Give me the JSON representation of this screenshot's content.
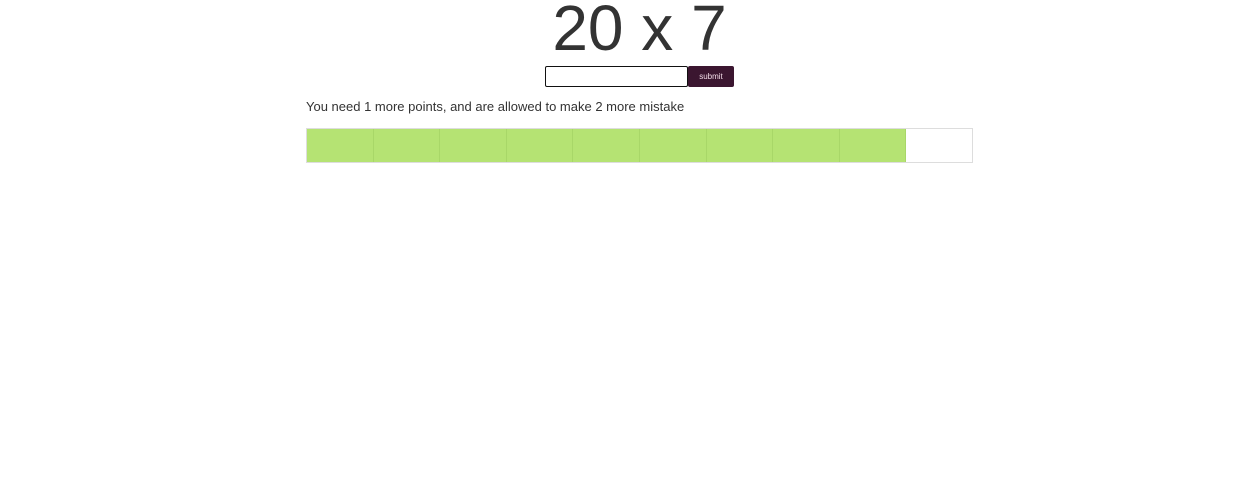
{
  "problem": {
    "text": "20 x 7"
  },
  "answer": {
    "value": "",
    "placeholder": ""
  },
  "submit": {
    "label": "submit"
  },
  "message": {
    "text": "You need 1 more points, and are allowed to make 2 more mistake"
  },
  "progress": {
    "total_segments": 10,
    "filled_segments": 9
  },
  "colors": {
    "filled": "#b5e373",
    "submit_bg": "#3b1630",
    "text": "#333333"
  }
}
